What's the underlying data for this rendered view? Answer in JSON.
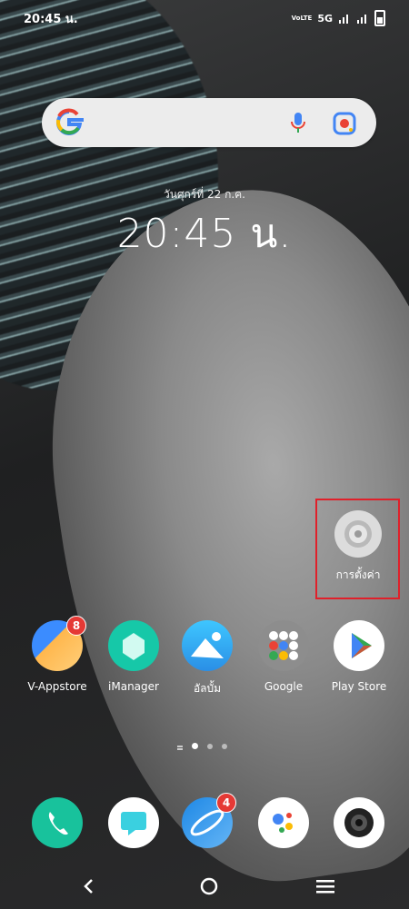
{
  "status_bar": {
    "time": "20:45 น.",
    "network": "5G",
    "volte": "VoLTE"
  },
  "search_bar": {
    "google_icon": "google-g-icon",
    "mic_icon": "microphone-icon",
    "lens_icon": "camera-lens-icon"
  },
  "clock": {
    "date": "วันศุกร์ที่ 22 ก.ค.",
    "time": "20:45 น."
  },
  "highlighted_app": {
    "label": "การตั้งค่า",
    "icon": "gear-icon",
    "highlight_color": "#e0202a"
  },
  "apps": [
    {
      "label": "V-Appstore",
      "badge": "8",
      "icon": "v-appstore-icon"
    },
    {
      "label": "iManager",
      "icon": "imanager-icon"
    },
    {
      "label": "อัลบั้ม",
      "icon": "album-icon"
    },
    {
      "label": "Google",
      "icon": "google-folder-icon"
    },
    {
      "label": "Play Store",
      "icon": "play-store-icon"
    }
  ],
  "dock": [
    {
      "icon": "phone-icon"
    },
    {
      "icon": "messages-icon"
    },
    {
      "icon": "browser-icon",
      "badge": "4"
    },
    {
      "icon": "google-assistant-icon"
    },
    {
      "icon": "camera-icon"
    }
  ],
  "page_indicator": {
    "pages": 3,
    "active": 1
  },
  "navigation": [
    "back-icon",
    "home-icon",
    "menu-icon"
  ]
}
